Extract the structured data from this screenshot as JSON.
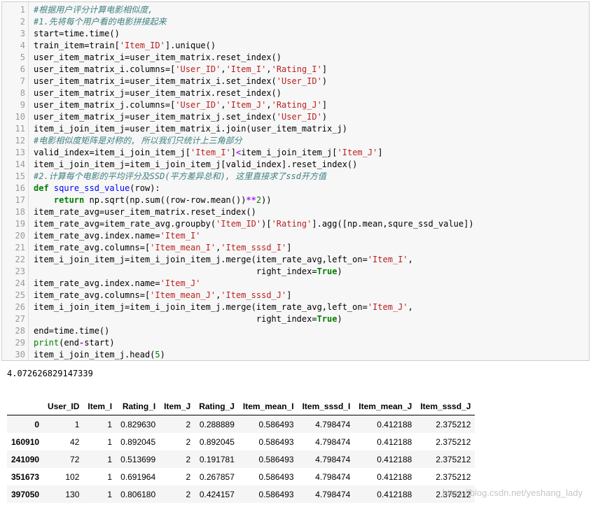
{
  "code_cell": {
    "lines": [
      [
        [
          "com",
          "#根据用户评分计算电影相似度,"
        ]
      ],
      [
        [
          "com",
          "#1.先将每个用户看的电影拼接起来"
        ]
      ],
      [
        [
          "txt",
          "start=time.time()"
        ]
      ],
      [
        [
          "txt",
          "train_item=train["
        ],
        [
          "str",
          "'Item_ID'"
        ],
        [
          "txt",
          "].unique()"
        ]
      ],
      [
        [
          "txt",
          "user_item_matrix_i=user_item_matrix.reset_index()"
        ]
      ],
      [
        [
          "txt",
          "user_item_matrix_i.columns=["
        ],
        [
          "str",
          "'User_ID'"
        ],
        [
          "txt",
          ","
        ],
        [
          "str",
          "'Item_I'"
        ],
        [
          "txt",
          ","
        ],
        [
          "str",
          "'Rating_I'"
        ],
        [
          "txt",
          "]"
        ]
      ],
      [
        [
          "txt",
          "user_item_matrix_i=user_item_matrix_i.set_index("
        ],
        [
          "str",
          "'User_ID'"
        ],
        [
          "txt",
          ")"
        ]
      ],
      [
        [
          "txt",
          "user_item_matrix_j=user_item_matrix.reset_index()"
        ]
      ],
      [
        [
          "txt",
          "user_item_matrix_j.columns=["
        ],
        [
          "str",
          "'User_ID'"
        ],
        [
          "txt",
          ","
        ],
        [
          "str",
          "'Item_J'"
        ],
        [
          "txt",
          ","
        ],
        [
          "str",
          "'Rating_J'"
        ],
        [
          "txt",
          "]"
        ]
      ],
      [
        [
          "txt",
          "user_item_matrix_j=user_item_matrix_j.set_index("
        ],
        [
          "str",
          "'User_ID'"
        ],
        [
          "txt",
          ")"
        ]
      ],
      [
        [
          "txt",
          "item_i_join_item_j=user_item_matrix_i.join(user_item_matrix_j)"
        ]
      ],
      [
        [
          "com",
          "#电影相似度矩阵是对称的, 所以我们只统计上三角部分"
        ]
      ],
      [
        [
          "txt",
          "valid_index=item_i_join_item_j["
        ],
        [
          "str",
          "'Item_I'"
        ],
        [
          "txt",
          "]"
        ],
        [
          "op",
          "<"
        ],
        [
          "txt",
          "item_i_join_item_j["
        ],
        [
          "str",
          "'Item_J'"
        ],
        [
          "txt",
          "]"
        ]
      ],
      [
        [
          "txt",
          "item_i_join_item_j=item_i_join_item_j[valid_index].reset_index()"
        ]
      ],
      [
        [
          "com",
          "#2.计算每个电影的平均评分及SSD(平方差异总和), 这里直接求了ssd开方值"
        ]
      ],
      [
        [
          "kw",
          "def"
        ],
        [
          "txt",
          " "
        ],
        [
          "def",
          "squre_ssd_value"
        ],
        [
          "txt",
          "(row):"
        ]
      ],
      [
        [
          "txt",
          "    "
        ],
        [
          "kw",
          "return"
        ],
        [
          "txt",
          " np.sqrt(np.sum((row-row.mean())"
        ],
        [
          "op",
          "**"
        ],
        [
          "num",
          "2"
        ],
        [
          "txt",
          "))"
        ]
      ],
      [
        [
          "txt",
          "item_rate_avg=user_item_matrix.reset_index()"
        ]
      ],
      [
        [
          "txt",
          "item_rate_avg=item_rate_avg.groupby("
        ],
        [
          "str",
          "'Item_ID'"
        ],
        [
          "txt",
          ")["
        ],
        [
          "str",
          "'Rating'"
        ],
        [
          "txt",
          "].agg([np.mean,squre_ssd_value])"
        ]
      ],
      [
        [
          "txt",
          "item_rate_avg.index.name="
        ],
        [
          "str",
          "'Item_I'"
        ]
      ],
      [
        [
          "txt",
          "item_rate_avg.columns=["
        ],
        [
          "str",
          "'Item_mean_I'"
        ],
        [
          "txt",
          ","
        ],
        [
          "str",
          "'Item_sssd_I'"
        ],
        [
          "txt",
          "]"
        ]
      ],
      [
        [
          "txt",
          "item_i_join_item_j=item_i_join_item_j.merge(item_rate_avg,left_on="
        ],
        [
          "str",
          "'Item_I'"
        ],
        [
          "txt",
          ","
        ]
      ],
      [
        [
          "txt",
          "                                            right_index="
        ],
        [
          "kw",
          "True"
        ],
        [
          "txt",
          ")"
        ]
      ],
      [
        [
          "txt",
          "item_rate_avg.index.name="
        ],
        [
          "str",
          "'Item_J'"
        ]
      ],
      [
        [
          "txt",
          "item_rate_avg.columns=["
        ],
        [
          "str",
          "'Item_mean_J'"
        ],
        [
          "txt",
          ","
        ],
        [
          "str",
          "'Item_sssd_J'"
        ],
        [
          "txt",
          "]"
        ]
      ],
      [
        [
          "txt",
          "item_i_join_item_j=item_i_join_item_j.merge(item_rate_avg,left_on="
        ],
        [
          "str",
          "'Item_J'"
        ],
        [
          "txt",
          ","
        ]
      ],
      [
        [
          "txt",
          "                                            right_index="
        ],
        [
          "kw",
          "True"
        ],
        [
          "txt",
          ")"
        ]
      ],
      [
        [
          "txt",
          "end=time.time()"
        ]
      ],
      [
        [
          "kwn",
          "print"
        ],
        [
          "txt",
          "(end"
        ],
        [
          "op",
          "-"
        ],
        [
          "txt",
          "start)"
        ]
      ],
      [
        [
          "txt",
          "item_i_join_item_j.head("
        ],
        [
          "num",
          "5"
        ],
        [
          "txt",
          ")"
        ]
      ]
    ]
  },
  "output": {
    "elapsed": "4.072626829147339"
  },
  "dataframe": {
    "columns": [
      "",
      "User_ID",
      "Item_I",
      "Rating_I",
      "Item_J",
      "Rating_J",
      "Item_mean_I",
      "Item_sssd_I",
      "Item_mean_J",
      "Item_sssd_J"
    ],
    "rows": [
      [
        "0",
        "1",
        "1",
        "0.829630",
        "2",
        "0.288889",
        "0.586493",
        "4.798474",
        "0.412188",
        "2.375212"
      ],
      [
        "160910",
        "42",
        "1",
        "0.892045",
        "2",
        "0.892045",
        "0.586493",
        "4.798474",
        "0.412188",
        "2.375212"
      ],
      [
        "241090",
        "72",
        "1",
        "0.513699",
        "2",
        "0.191781",
        "0.586493",
        "4.798474",
        "0.412188",
        "2.375212"
      ],
      [
        "351673",
        "102",
        "1",
        "0.691964",
        "2",
        "0.267857",
        "0.586493",
        "4.798474",
        "0.412188",
        "2.375212"
      ],
      [
        "397050",
        "130",
        "1",
        "0.806180",
        "2",
        "0.424157",
        "0.586493",
        "4.798474",
        "0.412188",
        "2.375212"
      ]
    ]
  },
  "watermark": "https://blog.csdn.net/yeshang_lady"
}
